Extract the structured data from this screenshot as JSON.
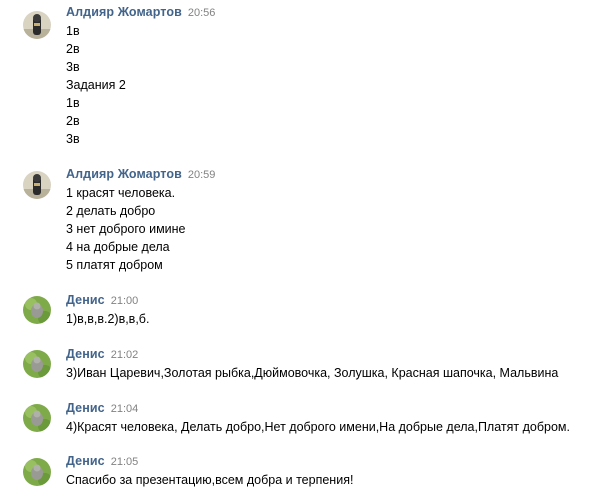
{
  "messages": [
    {
      "author": "Алдияр Жомартов",
      "time": "20:56",
      "avatar": "user-photo-icon",
      "lines": [
        "1в",
        "2в",
        "3в",
        "Задания 2",
        "1в",
        "2в",
        "3в"
      ]
    },
    {
      "author": "Алдияр Жомартов",
      "time": "20:59",
      "avatar": "user-photo-icon",
      "lines": [
        "1 красят человека.",
        "2 делать добро",
        "3 нет доброго имине",
        "4 на добрые дела",
        "5 платят добром"
      ]
    },
    {
      "author": "Денис",
      "time": "21:00",
      "avatar": "user-photo-icon",
      "lines": [
        "1)в,в,в.2)в,в,б."
      ]
    },
    {
      "author": "Денис",
      "time": "21:02",
      "avatar": "user-photo-icon",
      "lines": [
        "3)Иван Царевич,Золотая рыбка,Дюймовочка, Золушка, Красная шапочка, Мальвина"
      ]
    },
    {
      "author": "Денис",
      "time": "21:04",
      "avatar": "user-photo-icon",
      "lines": [
        "4)Красят человека, Делать добро,Нет доброго имени,На добрые дела,Платят добром."
      ]
    },
    {
      "author": "Денис",
      "time": "21:05",
      "avatar": "user-photo-icon",
      "lines": [
        "Спасибо за презентацию,всем добра и терпения!"
      ]
    }
  ],
  "colors": {
    "author": "#42648b",
    "time": "#828282",
    "text": "#000000",
    "background": "#ffffff"
  }
}
